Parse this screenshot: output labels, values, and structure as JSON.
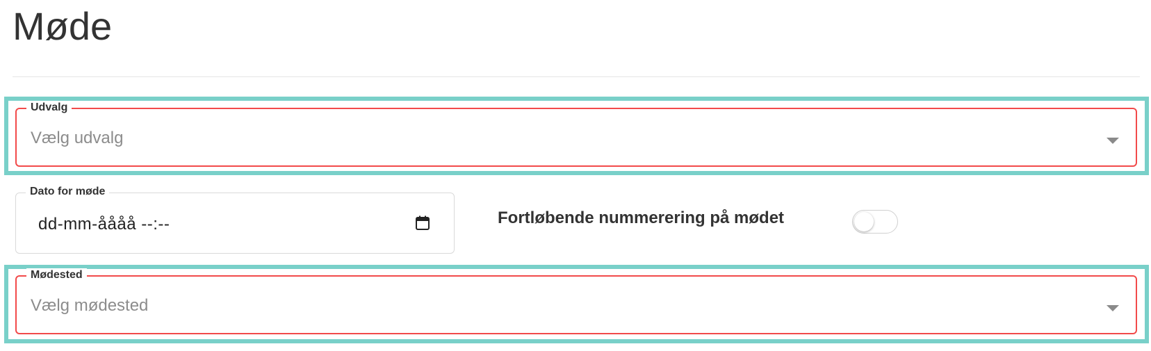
{
  "page": {
    "title": "Møde"
  },
  "form": {
    "udvalg": {
      "label": "Udvalg",
      "placeholder": "Vælg udvalg"
    },
    "dato": {
      "label": "Dato for møde",
      "value": "dd-mm-åååå --:--"
    },
    "nummerering": {
      "label": "Fortløbende nummerering på mødet",
      "checked": false
    },
    "moedested": {
      "label": "Mødested",
      "placeholder": "Vælg mødested"
    }
  },
  "colors": {
    "highlight": "#79d0c9",
    "error_border": "#f24a4a",
    "text": "#333333",
    "placeholder": "#8c8c8c"
  }
}
